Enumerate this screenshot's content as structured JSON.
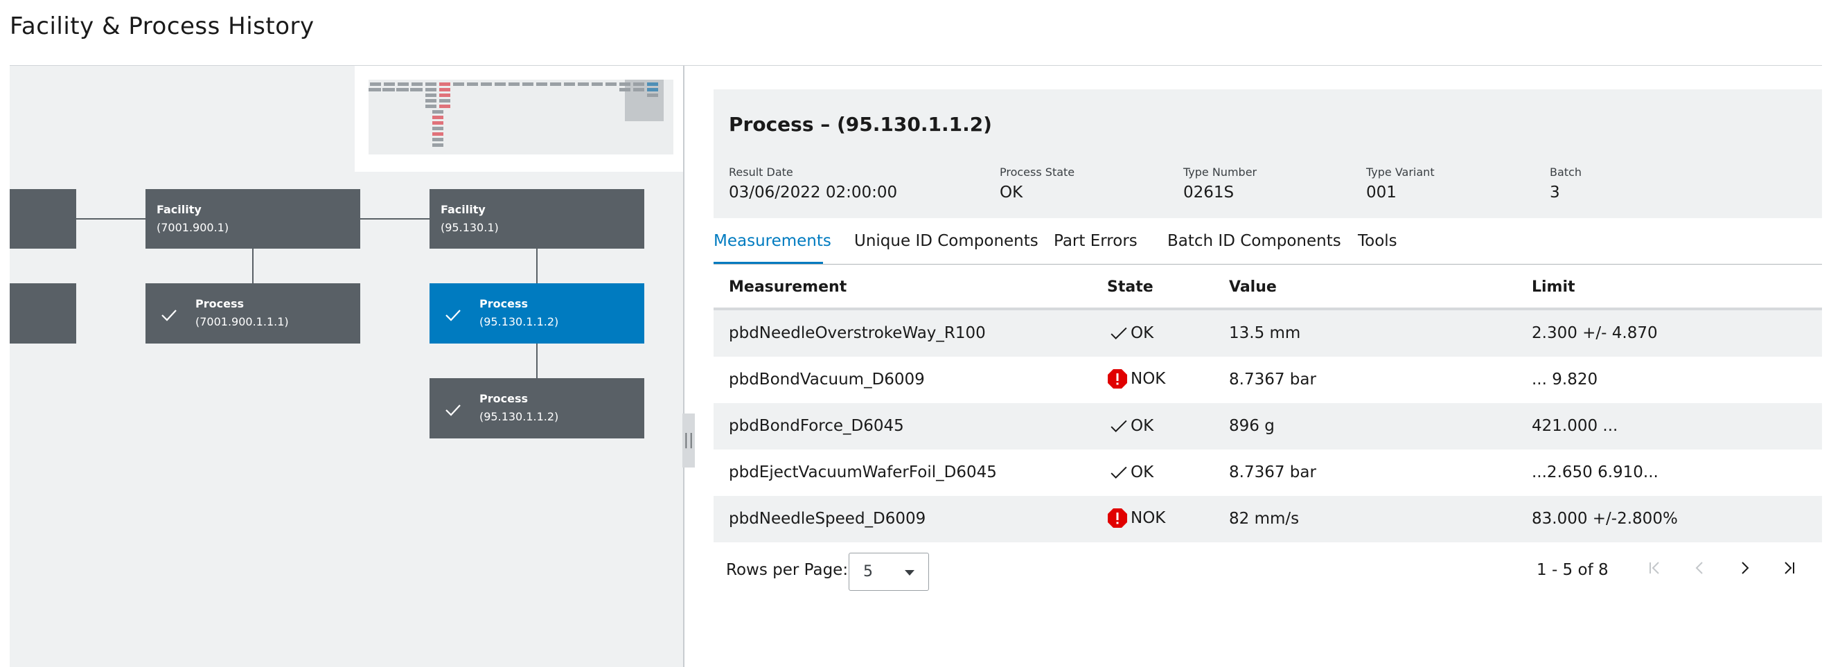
{
  "page": {
    "title": "Facility & Process History"
  },
  "graph": {
    "nodes": [
      {
        "id": "facility-7001",
        "title": "Facility",
        "sub": "(7001.900.1)"
      },
      {
        "id": "facility-95",
        "title": "Facility",
        "sub": "(95.130.1)"
      },
      {
        "id": "process-7001",
        "title": "Process",
        "sub": "(7001.900.1.1.1)"
      },
      {
        "id": "process-95-selected",
        "title": "Process",
        "sub": "(95.130.1.1.2)"
      },
      {
        "id": "process-95-second",
        "title": "Process",
        "sub": "(95.130.1.1.2)"
      }
    ]
  },
  "detail": {
    "title": "Process – (95.130.1.1.2)",
    "fields": [
      {
        "label": "Result Date",
        "value": "03/06/2022 02:00:00"
      },
      {
        "label": "Process State",
        "value": "OK"
      },
      {
        "label": "Type Number",
        "value": "0261S"
      },
      {
        "label": "Type Variant",
        "value": "001"
      },
      {
        "label": "Batch",
        "value": "3"
      }
    ]
  },
  "tabs": [
    "Measurements",
    "Unique ID Components",
    "Part Errors",
    "Batch ID Components",
    "Tools"
  ],
  "table": {
    "headers": [
      "Measurement",
      "State",
      "Value",
      "Limit"
    ],
    "rows": [
      {
        "measurement": "pbdNeedleOverstrokeWay_R100",
        "state": "OK",
        "value": "13.5 mm",
        "limit": "2.300 +/- 4.870"
      },
      {
        "measurement": "pbdBondVacuum_D6009",
        "state": "NOK",
        "value": "8.7367 bar",
        "limit": "... 9.820"
      },
      {
        "measurement": "pbdBondForce_D6045",
        "state": "OK",
        "value": "896 g",
        "limit": "421.000 ..."
      },
      {
        "measurement": "pbdEjectVacuumWaferFoil_D6045",
        "state": "OK",
        "value": "8.7367 bar",
        "limit": "...2.650 6.910..."
      },
      {
        "measurement": "pbdNeedleSpeed_D6009",
        "state": "NOK",
        "value": "82 mm/s",
        "limit": "83.000 +/-2.800%"
      }
    ]
  },
  "pager": {
    "rows_per_page_label": "Rows per Page:",
    "rows_per_page": "5",
    "range": "1 - 5 of 8"
  },
  "colors": {
    "accent": "#007bc0",
    "node": "#596066",
    "error": "#e00000"
  },
  "icons": [
    "check-icon",
    "error-icon",
    "first-page-icon",
    "prev-page-icon",
    "next-page-icon",
    "last-page-icon",
    "caret-down-icon",
    "splitter-grip-icon"
  ]
}
